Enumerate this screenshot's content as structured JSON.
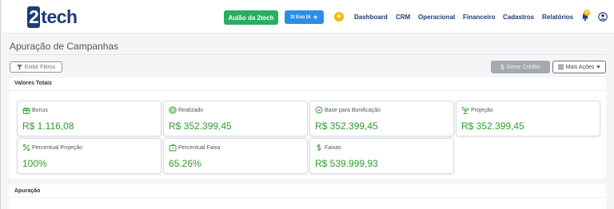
{
  "logo": {
    "text_a": "2",
    "text_b": "tech"
  },
  "header": {
    "aulao_label": "Aulão da 2tech",
    "evo_label": "2t Evo IA",
    "notification_count": "25",
    "nav": [
      "Dashboard",
      "CRM",
      "Operacional",
      "Financeiro",
      "Cadastros",
      "Relatórios"
    ]
  },
  "page": {
    "title": "Apuração de Campanhas"
  },
  "toolbar": {
    "filter_label": "Exibir Filtros",
    "credit_label": "Gerar Crédito",
    "more_label": "Mais Ações"
  },
  "totals": {
    "title": "Valores Totais",
    "metrics": [
      {
        "label": "Bonus",
        "value": "R$ 1.116,08",
        "icon": "gift-icon"
      },
      {
        "label": "Realizado",
        "value": "R$ 352.399,45",
        "icon": "target-icon"
      },
      {
        "label": "Base para Bonificação",
        "value": "R$ 352.399,45",
        "icon": "badge-check-icon"
      },
      {
        "label": "Projeção",
        "value": "R$ 352.399,45",
        "icon": "plant-icon"
      },
      {
        "label": "Percentual Projeção",
        "value": "100%",
        "icon": "percent-icon"
      },
      {
        "label": "Percentual Faixa",
        "value": "65.26%",
        "icon": "wallet-icon"
      },
      {
        "label": "Faixas",
        "value": "R$ 539.999,93",
        "icon": "dollar-icon"
      }
    ]
  },
  "apuracao": {
    "title": "Apuração"
  },
  "colors": {
    "brand": "#1d3b77",
    "green_button": "#27ae60",
    "blue_button": "#2c8de9",
    "value_green": "#2e9c2e",
    "accent_yellow": "#f5b800"
  }
}
